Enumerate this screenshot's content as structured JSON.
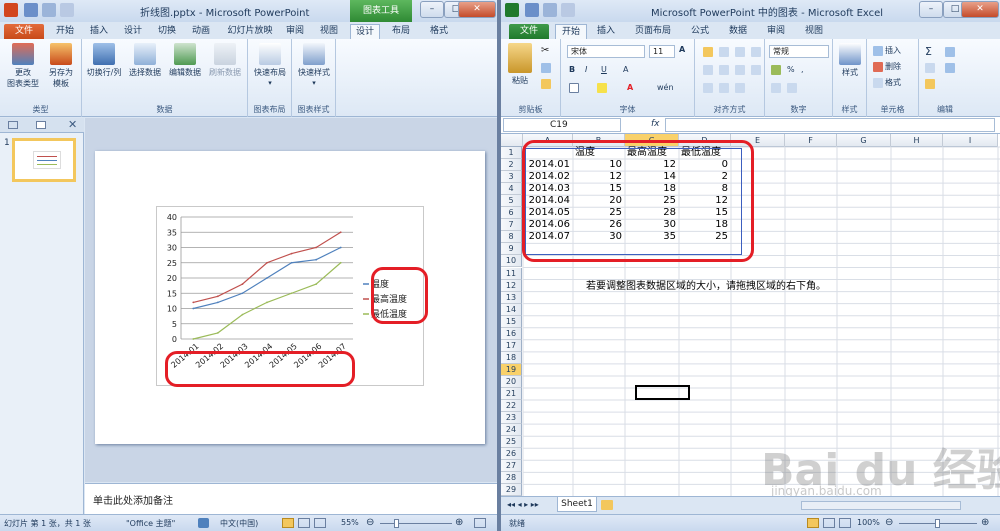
{
  "ppt": {
    "title": "折线图.pptx - Microsoft PowerPoint",
    "chart_tools_label": "图表工具",
    "tabs": [
      "文件",
      "开始",
      "插入",
      "设计",
      "切换",
      "动画",
      "幻灯片放映",
      "审阅",
      "视图",
      "设计",
      "布局",
      "格式"
    ],
    "groups": [
      {
        "label": "类型",
        "buttons": [
          "更改\n图表类型",
          "另存为\n模板"
        ]
      },
      {
        "label": "数据",
        "buttons": [
          "切换行/列",
          "选择数据",
          "编辑数据",
          "刷新数据"
        ]
      },
      {
        "label": "图表布局",
        "buttons": [
          "快速布局"
        ]
      },
      {
        "label": "图表样式",
        "buttons": [
          "快速样式"
        ]
      }
    ],
    "thumb_number": "1",
    "notes_placeholder": "单击此处添加备注",
    "status": {
      "slide": "幻灯片 第 1 张，共 1 张",
      "theme": "\"Office 主题\"",
      "lang": "中文(中国)",
      "zoom": "55%"
    }
  },
  "xls": {
    "title": "Microsoft PowerPoint 中的图表 - Microsoft Excel",
    "tabs": [
      "文件",
      "开始",
      "插入",
      "页面布局",
      "公式",
      "数据",
      "审阅",
      "视图"
    ],
    "groups": [
      {
        "label": "剪贴板",
        "buttons": [
          "粘贴"
        ]
      },
      {
        "label": "字体",
        "font_name": "宋体",
        "font_size": "11"
      },
      {
        "label": "对齐方式"
      },
      {
        "label": "数字",
        "format": "常规"
      },
      {
        "label": "样式",
        "buttons": [
          "样式"
        ]
      },
      {
        "label": "单元格",
        "buttons": [
          "插入",
          "删除",
          "格式"
        ]
      },
      {
        "label": "编辑"
      }
    ],
    "namebox": "C19",
    "fx": "fx",
    "columns": [
      "A",
      "B",
      "C",
      "D",
      "E",
      "F",
      "G",
      "H",
      "I"
    ],
    "rows": [
      "1",
      "2",
      "3",
      "4",
      "5",
      "6",
      "7",
      "8",
      "9",
      "10",
      "11",
      "12",
      "13",
      "14",
      "15",
      "16",
      "17",
      "18",
      "19",
      "20",
      "21",
      "22",
      "23",
      "24",
      "25",
      "26",
      "27",
      "28",
      "29"
    ],
    "table": {
      "headers": [
        "",
        "温度",
        "最高温度",
        "最低温度"
      ],
      "rows": [
        [
          "2014.01",
          "10",
          "12",
          "0"
        ],
        [
          "2014.02",
          "12",
          "14",
          "2"
        ],
        [
          "2014.03",
          "15",
          "18",
          "8"
        ],
        [
          "2014.04",
          "20",
          "25",
          "12"
        ],
        [
          "2014.05",
          "25",
          "28",
          "15"
        ],
        [
          "2014.06",
          "26",
          "30",
          "18"
        ],
        [
          "2014.07",
          "30",
          "35",
          "25"
        ]
      ]
    },
    "hint": "若要调整图表数据区域的大小，请拖拽区域的右下角。",
    "sheet_tab": "Sheet1",
    "status": {
      "ready": "就绪",
      "zoom": "100%"
    }
  },
  "watermark": {
    "text": "Bai du 经验",
    "sub": "jingyan.baidu.com"
  },
  "chart_data": {
    "type": "line",
    "categories": [
      "2014.01",
      "2014.02",
      "2014.03",
      "2014.04",
      "2014.05",
      "2014.06",
      "2014.07"
    ],
    "series": [
      {
        "name": "温度",
        "values": [
          10,
          12,
          15,
          20,
          25,
          26,
          30
        ],
        "color": "#4f81bd"
      },
      {
        "name": "最高温度",
        "values": [
          12,
          14,
          18,
          25,
          28,
          30,
          35
        ],
        "color": "#c0504d"
      },
      {
        "name": "最低温度",
        "values": [
          0,
          2,
          8,
          12,
          15,
          18,
          25
        ],
        "color": "#9bbb59"
      }
    ],
    "yticks": [
      "0",
      "5",
      "10",
      "15",
      "20",
      "25",
      "30",
      "35",
      "40"
    ],
    "ylim": [
      0,
      40
    ],
    "grid": true,
    "legend": "right"
  }
}
